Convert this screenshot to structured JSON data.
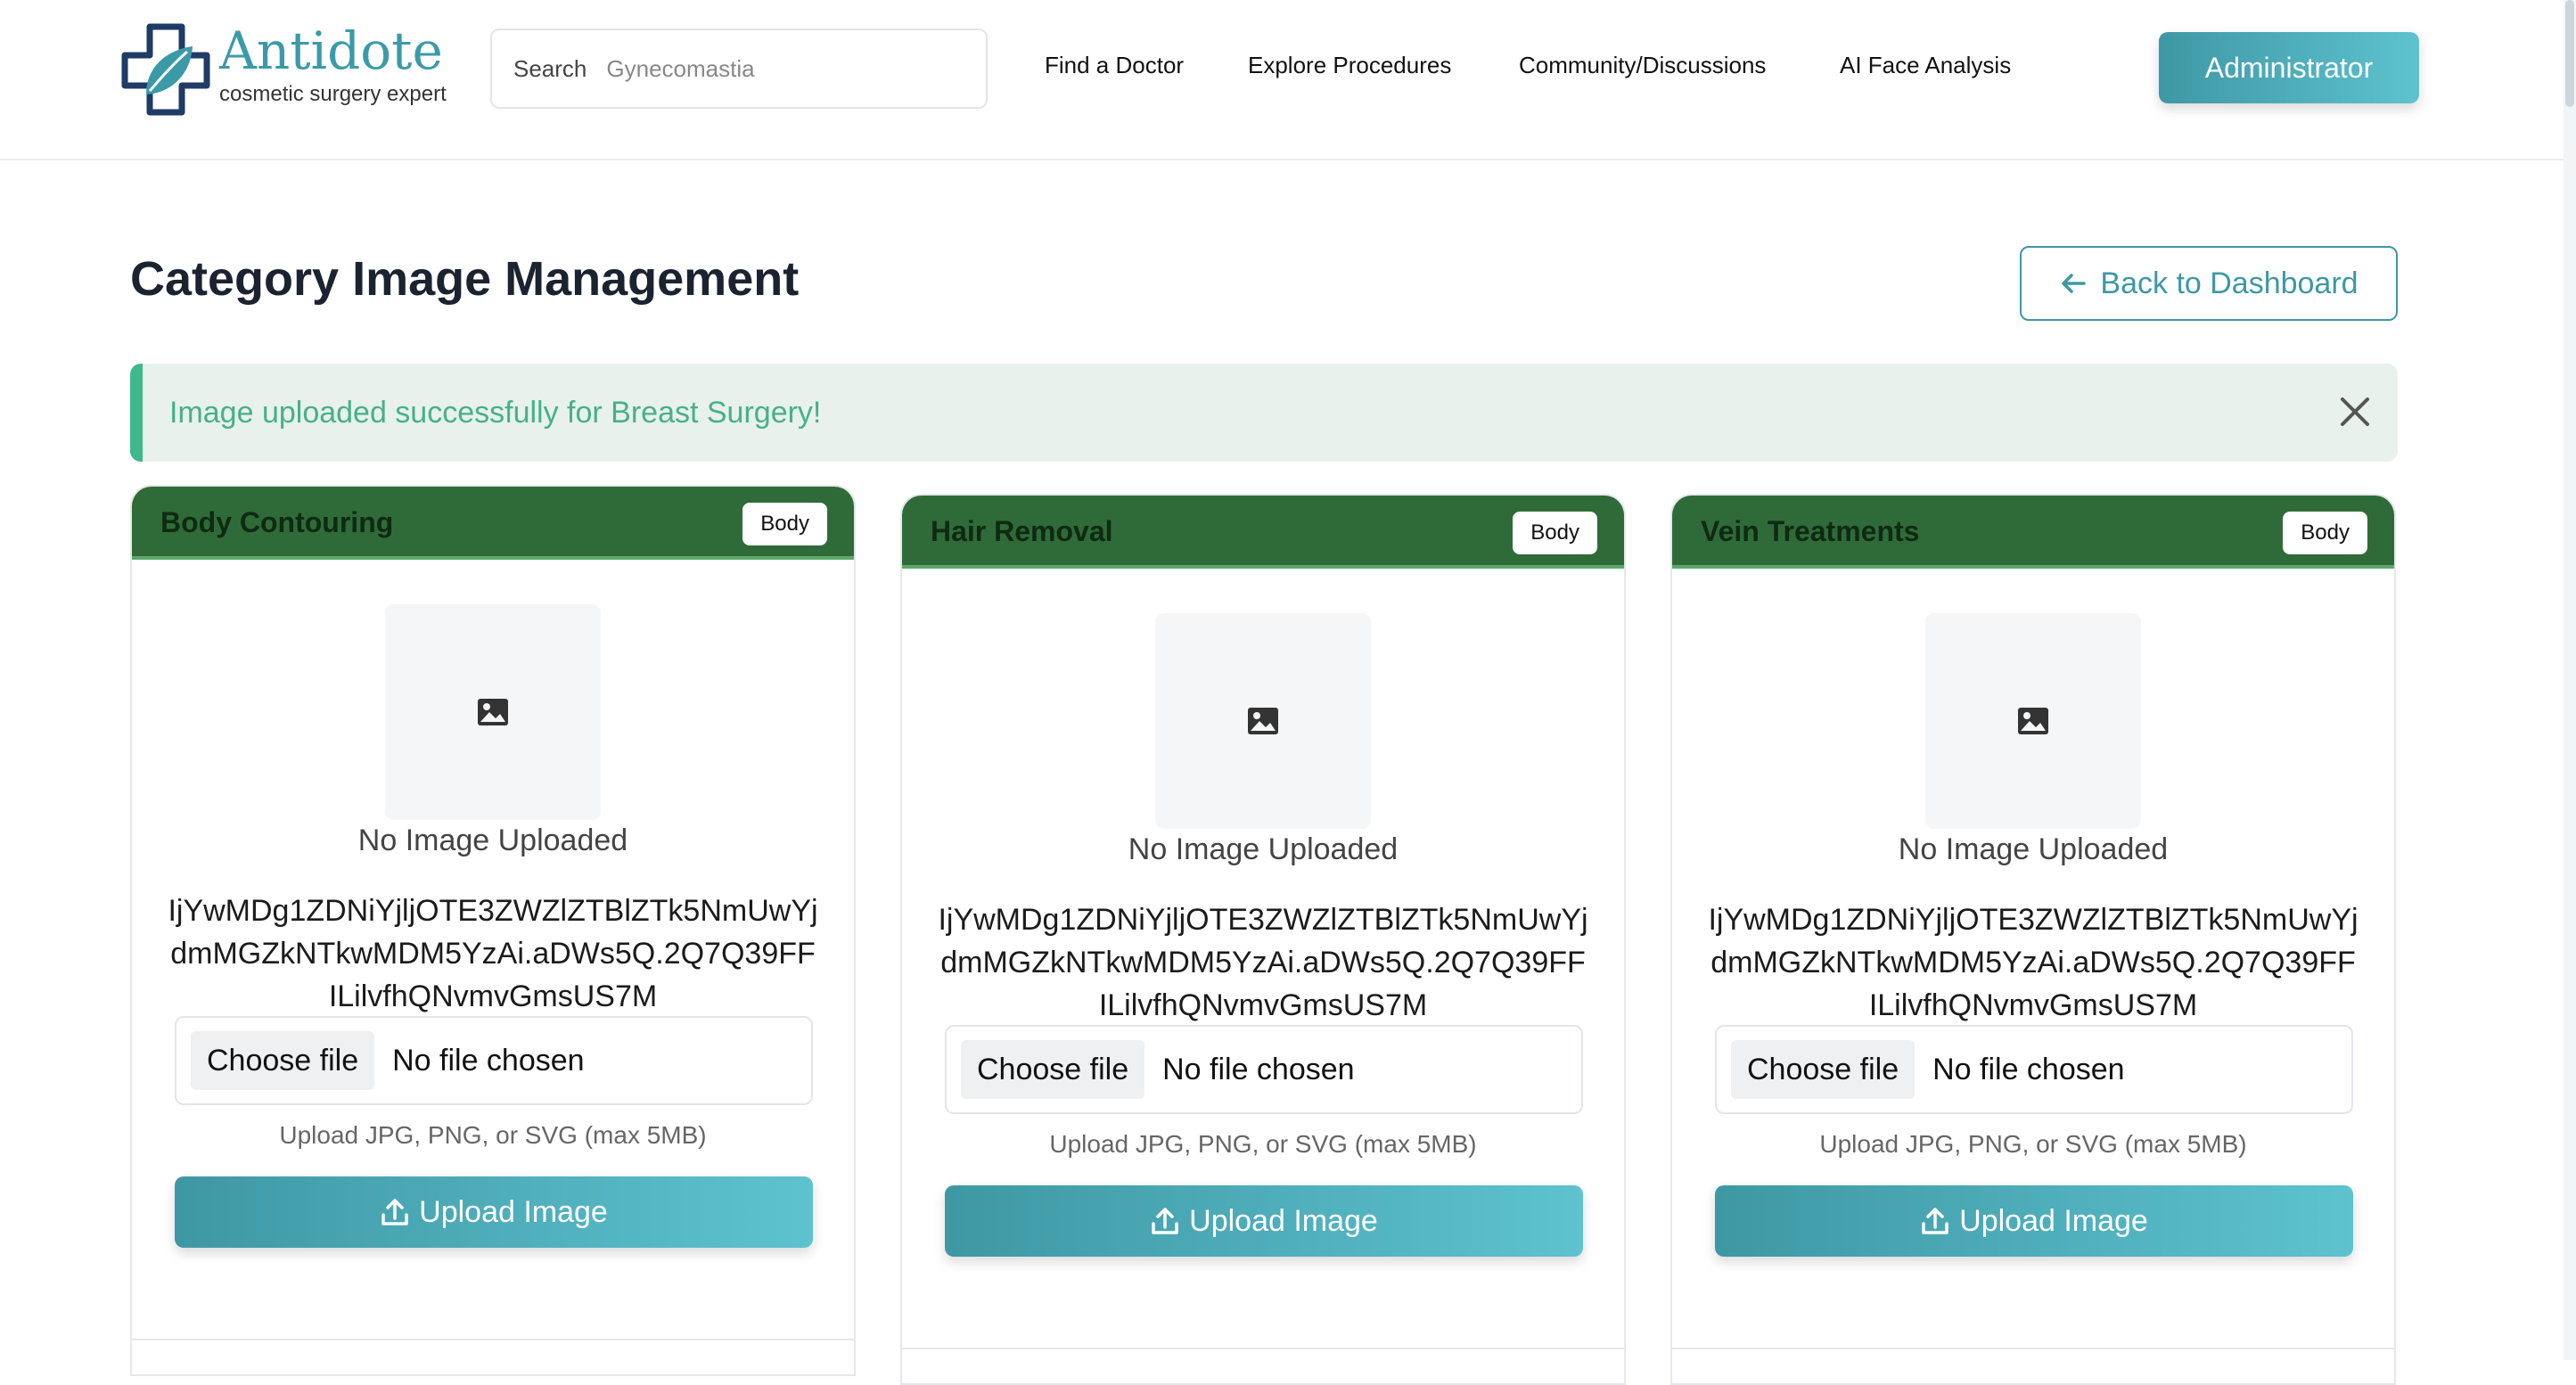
{
  "header": {
    "logo": {
      "title": "Antidote",
      "subtitle": "cosmetic surgery expert"
    },
    "search": {
      "label": "Search",
      "placeholder": "Gynecomastia"
    },
    "nav": [
      {
        "label": "Find a Doctor"
      },
      {
        "label": "Explore Procedures"
      },
      {
        "label": "Community/Discussions"
      },
      {
        "label": "AI Face Analysis"
      }
    ],
    "user_button": "Administrator"
  },
  "page": {
    "title": "Category Image Management",
    "back_button": "Back to Dashboard"
  },
  "alert": {
    "message": "Image uploaded successfully for Breast Surgery!"
  },
  "cards": [
    {
      "title": "Body Contouring",
      "badge": "Body",
      "image_status": "No Image Uploaded",
      "token": "IjYwMDg1ZDNiYjljOTE3ZWZlZTBlZTk5NmUwYjdmMGZkNTkwMDM5YzAi.aDWs5Q.2Q7Q39FFILilvfhQNvmvGmsUS7M",
      "choose_file": "Choose file",
      "file_status": "No file chosen",
      "hint": "Upload JPG, PNG, or SVG (max 5MB)",
      "upload_button": "Upload Image"
    },
    {
      "title": "Hair Removal",
      "badge": "Body",
      "image_status": "No Image Uploaded",
      "token": "IjYwMDg1ZDNiYjljOTE3ZWZlZTBlZTk5NmUwYjdmMGZkNTkwMDM5YzAi.aDWs5Q.2Q7Q39FFILilvfhQNvmvGmsUS7M",
      "choose_file": "Choose file",
      "file_status": "No file chosen",
      "hint": "Upload JPG, PNG, or SVG (max 5MB)",
      "upload_button": "Upload Image"
    },
    {
      "title": "Vein Treatments",
      "badge": "Body",
      "image_status": "No Image Uploaded",
      "token": "IjYwMDg1ZDNiYjljOTE3ZWZlZTBlZTk5NmUwYjdmMGZkNTkwMDM5YzAi.aDWs5Q.2Q7Q39FFILilvfhQNvmvGmsUS7M",
      "choose_file": "Choose file",
      "file_status": "No file chosen",
      "hint": "Upload JPG, PNG, or SVG (max 5MB)",
      "upload_button": "Upload Image"
    }
  ],
  "icons": {
    "logo": "medical-cross-leaf-icon",
    "back": "arrow-left-icon",
    "close": "close-icon",
    "placeholder": "image-icon",
    "upload": "upload-icon"
  },
  "colors": {
    "brand": "#3e98a4",
    "card_header": "#2f6b38",
    "alert_bg": "#e8f1ec",
    "alert_text": "#47b08a"
  }
}
